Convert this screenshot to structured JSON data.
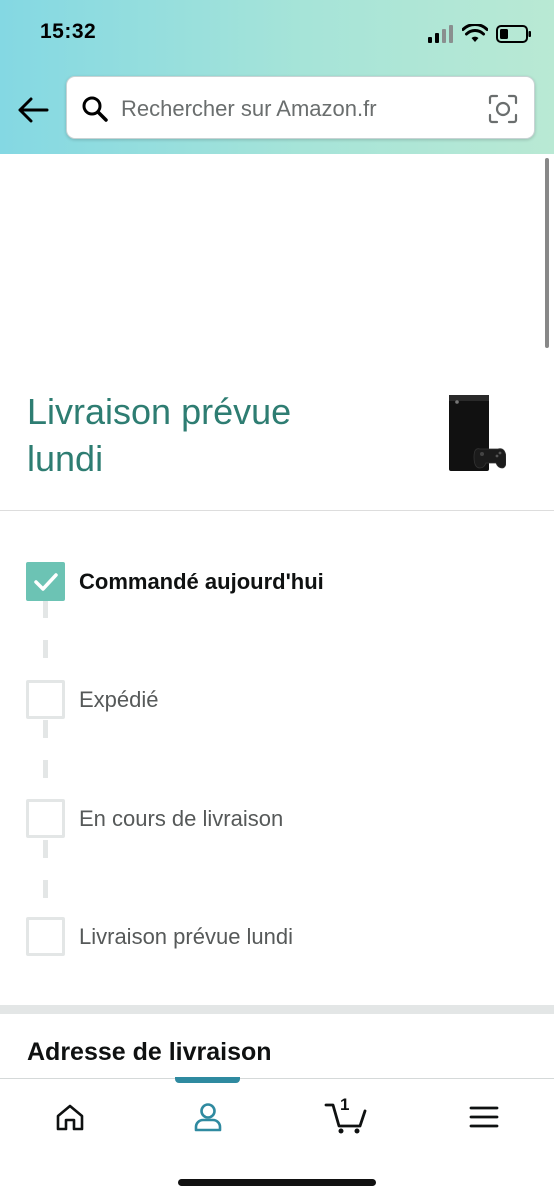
{
  "status_bar": {
    "time": "15:32"
  },
  "search": {
    "placeholder": "Rechercher sur Amazon.fr"
  },
  "icons": {
    "back": "arrow-left-icon",
    "search": "search-icon",
    "camera": "camera-scan-icon",
    "home": "home-icon",
    "account": "account-icon",
    "cart": "cart-icon",
    "menu": "menu-icon"
  },
  "delivery": {
    "title": "Livraison prévue lundi"
  },
  "tracking": {
    "steps": [
      {
        "label": "Commandé aujourd'hui",
        "done": true
      },
      {
        "label": "Expédié",
        "done": false
      },
      {
        "label": "En cours de livraison",
        "done": false
      },
      {
        "label": "Livraison prévue lundi",
        "done": false
      }
    ]
  },
  "address": {
    "heading": "Adresse de livraison"
  },
  "bottom_nav": {
    "active": "account",
    "cart_count": "1"
  },
  "colors": {
    "accent": "#2e7d72",
    "check": "#6cc3b4",
    "nav_active": "#2f8aa0"
  }
}
